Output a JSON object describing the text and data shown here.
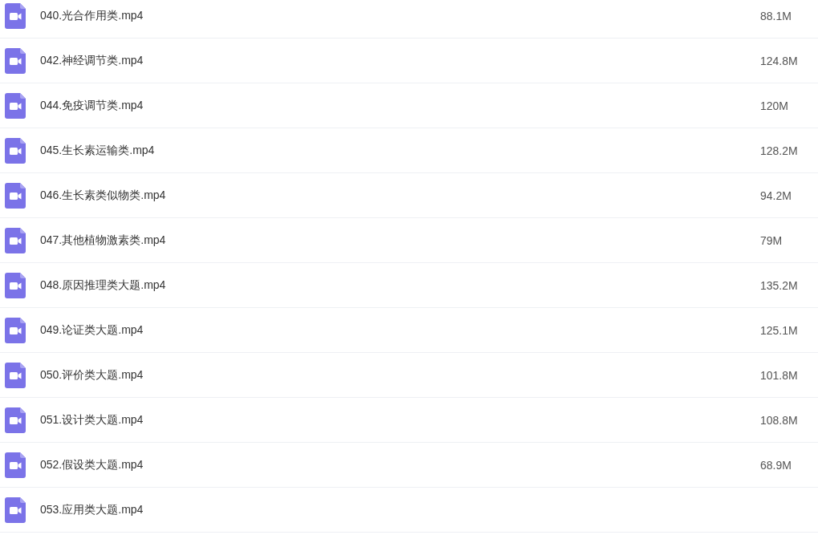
{
  "files": [
    {
      "name": "040.光合作用类.mp4",
      "size": "88.1M"
    },
    {
      "name": "042.神经调节类.mp4",
      "size": "124.8M"
    },
    {
      "name": "044.免疫调节类.mp4",
      "size": "120M"
    },
    {
      "name": "045.生长素运输类.mp4",
      "size": "128.2M"
    },
    {
      "name": "046.生长素类似物类.mp4",
      "size": "94.2M"
    },
    {
      "name": "047.其他植物激素类.mp4",
      "size": "79M"
    },
    {
      "name": "048.原因推理类大题.mp4",
      "size": "135.2M"
    },
    {
      "name": "049.论证类大题.mp4",
      "size": "125.1M"
    },
    {
      "name": "050.评价类大题.mp4",
      "size": "101.8M"
    },
    {
      "name": "051.设计类大题.mp4",
      "size": "108.8M"
    },
    {
      "name": "052.假设类大题.mp4",
      "size": "68.9M"
    },
    {
      "name": "053.应用类大题.mp4"
    }
  ]
}
